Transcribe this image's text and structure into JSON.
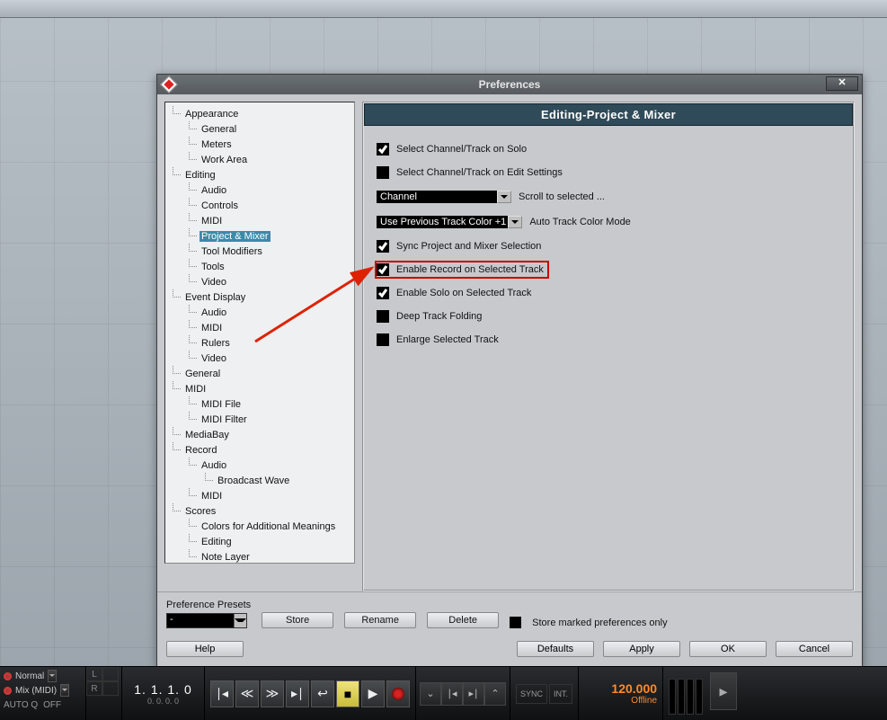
{
  "dialog": {
    "title": "Preferences",
    "close": "✕",
    "panel_title": "Editing-Project & Mixer",
    "tree": [
      {
        "level": 0,
        "label": "Appearance"
      },
      {
        "level": 1,
        "label": "General"
      },
      {
        "level": 1,
        "label": "Meters"
      },
      {
        "level": 1,
        "label": "Work Area"
      },
      {
        "level": 0,
        "label": "Editing"
      },
      {
        "level": 1,
        "label": "Audio"
      },
      {
        "level": 1,
        "label": "Controls"
      },
      {
        "level": 1,
        "label": "MIDI"
      },
      {
        "level": 1,
        "label": "Project & Mixer",
        "selected": true
      },
      {
        "level": 1,
        "label": "Tool Modifiers"
      },
      {
        "level": 1,
        "label": "Tools"
      },
      {
        "level": 1,
        "label": "Video"
      },
      {
        "level": 0,
        "label": "Event Display"
      },
      {
        "level": 1,
        "label": "Audio"
      },
      {
        "level": 1,
        "label": "MIDI"
      },
      {
        "level": 1,
        "label": "Rulers"
      },
      {
        "level": 1,
        "label": "Video"
      },
      {
        "level": 0,
        "label": "General"
      },
      {
        "level": 0,
        "label": "MIDI"
      },
      {
        "level": 1,
        "label": "MIDI File"
      },
      {
        "level": 1,
        "label": "MIDI Filter"
      },
      {
        "level": 0,
        "label": "MediaBay"
      },
      {
        "level": 0,
        "label": "Record"
      },
      {
        "level": 1,
        "label": "Audio"
      },
      {
        "level": 2,
        "label": "Broadcast Wave"
      },
      {
        "level": 1,
        "label": "MIDI"
      },
      {
        "level": 0,
        "label": "Scores"
      },
      {
        "level": 1,
        "label": "Colors for Additional Meanings"
      },
      {
        "level": 1,
        "label": "Editing"
      },
      {
        "level": 1,
        "label": "Note Layer"
      }
    ],
    "settings": {
      "solo": {
        "checked": true,
        "label": "Select Channel/Track on Solo"
      },
      "edit": {
        "checked": false,
        "label": "Select Channel/Track on Edit Settings"
      },
      "scroll_sel": {
        "value": "Channel",
        "label": "Scroll to selected ..."
      },
      "color_mode": {
        "value": "Use Previous Track Color +1",
        "label": "Auto Track Color Mode"
      },
      "sync": {
        "checked": true,
        "label": "Sync Project and Mixer Selection"
      },
      "rec_sel": {
        "checked": true,
        "label": "Enable Record on Selected Track"
      },
      "solo_sel": {
        "checked": true,
        "label": "Enable Solo on Selected Track"
      },
      "deep_fold": {
        "checked": false,
        "label": "Deep Track Folding"
      },
      "enlarge": {
        "checked": false,
        "label": "Enlarge Selected Track"
      }
    },
    "presets_label": "Preference Presets",
    "preset_value": "-",
    "store": "Store",
    "rename": "Rename",
    "delete": "Delete",
    "store_marked": "Store marked preferences only",
    "help": "Help",
    "defaults": "Defaults",
    "apply": "Apply",
    "ok": "OK",
    "cancel": "Cancel"
  },
  "transport": {
    "mode1": "Normal",
    "mode2": "Mix (MIDI)",
    "autoq": "AUTO Q",
    "off": "OFF",
    "L": "L",
    "R": "R",
    "timecode": "1. 1. 1.   0",
    "subtc": "0. 0. 0.   0",
    "sync": "SYNC",
    "int": "INT.",
    "tempo": "120.000",
    "offline": "Offline"
  }
}
